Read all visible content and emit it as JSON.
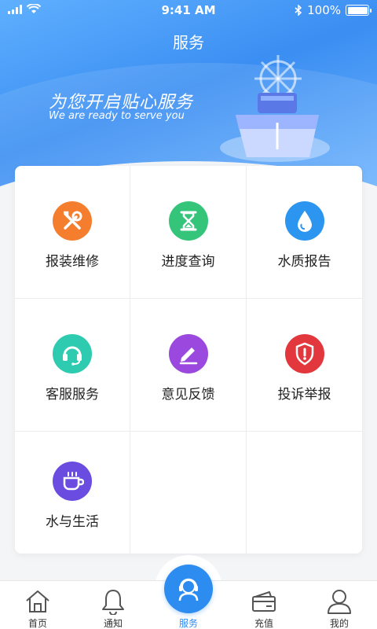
{
  "status_bar": {
    "time": "9:41 AM",
    "battery": "100%",
    "battery_level": 1.0
  },
  "header": {
    "title": "服务"
  },
  "hero": {
    "slogan": "为您开启贴心服务",
    "slogan_en": "We are ready  to serve you"
  },
  "services": [
    {
      "label": "报装维修",
      "icon": "tools-icon",
      "color": "#f57e2e"
    },
    {
      "label": "进度查询",
      "icon": "hourglass-icon",
      "color": "#34c57a"
    },
    {
      "label": "水质报告",
      "icon": "water-drop-icon",
      "color": "#2b95ef"
    },
    {
      "label": "客服服务",
      "icon": "headset-icon",
      "color": "#2ecbb0"
    },
    {
      "label": "意见反馈",
      "icon": "edit-icon",
      "color": "#9b48de"
    },
    {
      "label": "投诉举报",
      "icon": "shield-alert-icon",
      "color": "#e2373d"
    },
    {
      "label": "水与生活",
      "icon": "cup-icon",
      "color": "#6a4de0"
    }
  ],
  "tabbar": {
    "items": [
      {
        "label": "首页",
        "icon": "home-icon"
      },
      {
        "label": "通知",
        "icon": "bell-icon"
      },
      {
        "label": "服务",
        "icon": "customer-service-icon",
        "active": true
      },
      {
        "label": "充值",
        "icon": "wallet-icon"
      },
      {
        "label": "我的",
        "icon": "user-icon"
      }
    ]
  },
  "colors": {
    "accent": "#2d8cf0",
    "hero_top": "#5fb0ff",
    "hero_bottom": "#3b8ef2"
  }
}
